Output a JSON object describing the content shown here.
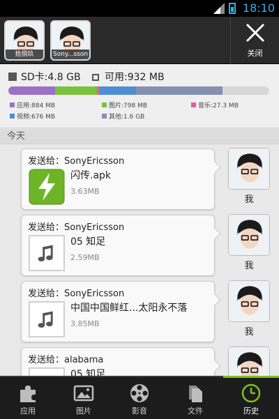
{
  "status_bar": {
    "time": "18:10",
    "icons": [
      "signal-icon",
      "battery-icon"
    ]
  },
  "top_bar": {
    "avatars": [
      {
        "caption": "拾捌玖",
        "icon": "avatar-icon"
      },
      {
        "caption": "Sony...sson",
        "icon": "avatar-icon"
      }
    ],
    "close_label": "关闭",
    "close_icon": "close-icon"
  },
  "storage": {
    "sd_label": "SD卡:4.8 GB",
    "free_label": "可用:932 MB",
    "usage_fractions": {
      "apps": 0.18,
      "images": 0.16,
      "music": 0.01,
      "video": 0.14,
      "other": 0.33,
      "free": 0.18
    },
    "legend": [
      {
        "label": "应用:884 MB",
        "color": "#9a72c8"
      },
      {
        "label": "图片:798 MB",
        "color": "#78c23c"
      },
      {
        "label": "音乐:27.3 MB",
        "color": "#e0609a"
      },
      {
        "label": "视频:676 MB",
        "color": "#4d8fd0"
      },
      {
        "label": "其他:1.6 GB",
        "color": "#8690b0"
      }
    ]
  },
  "section_header": "今天",
  "transfers": [
    {
      "title": "发送给：SonyEricsson",
      "file_name": "闪传.apk",
      "size": "3.63MB",
      "thumb": "lightning-app-icon",
      "sender": "我"
    },
    {
      "title": "发送给：SonyEricsson",
      "file_name": "05 知足",
      "size": "2.59MB",
      "thumb": "music-note-icon",
      "sender": "我"
    },
    {
      "title": "发送给：SonyEricsson",
      "file_name": "中国中国鲜红...太阳永不落",
      "size": "3.85MB",
      "thumb": "music-note-icon",
      "sender": "我"
    },
    {
      "title": "发送给：alabama",
      "file_name": "05 知足",
      "size": "",
      "thumb": "music-note-icon",
      "sender": ""
    }
  ],
  "bottom_nav": [
    {
      "label": "应用",
      "icon": "puzzle-icon",
      "active": false
    },
    {
      "label": "图片",
      "icon": "picture-icon",
      "active": false
    },
    {
      "label": "影音",
      "icon": "film-reel-icon",
      "active": false
    },
    {
      "label": "文件",
      "icon": "files-icon",
      "active": false
    },
    {
      "label": "历史",
      "icon": "clock-icon",
      "active": true
    }
  ],
  "colors": {
    "accent": "#7ec21d",
    "status_blue": "#35b3e6",
    "topbar": "#2a2a2a"
  }
}
